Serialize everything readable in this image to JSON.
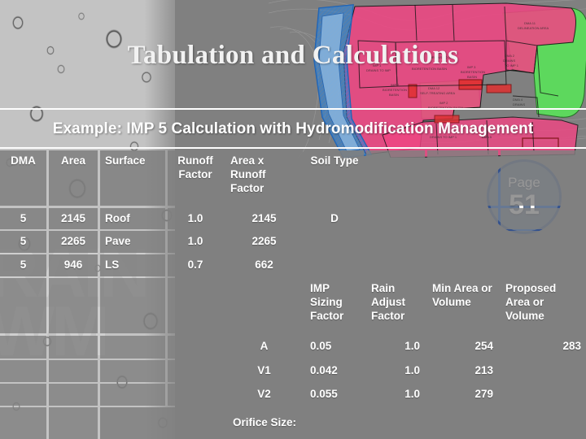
{
  "slide": {
    "title": "Tabulation and Calculations",
    "subtitle": "Example: IMP 5 Calculation with Hydromodification Management",
    "watermark_text": "RAIN\nWM"
  },
  "page_badge": {
    "label": "Page",
    "number": "51",
    "fill_color": "#466eaf",
    "border_color": "#2d4b8c"
  },
  "colors": {
    "background_gray": "#808080",
    "droplet_band": "#c3c3c3",
    "cell_gray": "#808080",
    "text_white": "#ffffff",
    "map_pink": "#ef4683",
    "map_blue": "#2f7fd4",
    "map_light_blue": "#88b4de",
    "map_green": "#5be05b",
    "map_red": "#e03030"
  },
  "map": {
    "name": "site-plan-drainage-map",
    "labels": [
      "DMA 11 DELINEATION AREA",
      "DMA 3 DRAINS TO IMP 5",
      "IMP 1 DRAINS TO IMP",
      "IMP 7 BIORETENTION BASIN",
      "IMP 3 BIORETENTION BASIN",
      "DMA 12 SELF-TREATING AREA",
      "IMP 2 BIORETENTION BASIN",
      "DMA 2 DRAINS TO IMP 1",
      "DMA 4 DRAINS",
      "DRAINS TO IMP 1"
    ]
  },
  "table_top": {
    "headers": [
      "DMA",
      "Area",
      "Surface",
      "Runoff Factor",
      "Area x Runoff Factor",
      "Soil Type",
      "",
      "",
      ""
    ],
    "rows": [
      [
        "5",
        "2145",
        "Roof",
        "1.0",
        "2145",
        "D",
        "",
        "",
        ""
      ],
      [
        "5",
        "2265",
        "Pave",
        "1.0",
        "2265",
        "",
        "",
        "",
        ""
      ],
      [
        "5",
        "946",
        "LS",
        "0.7",
        "662",
        "",
        "",
        "",
        ""
      ]
    ]
  },
  "table_bottom": {
    "headers": [
      "",
      "",
      "IMP Sizing Factor",
      "Rain Adjust Factor",
      "Min Area or Volume",
      "Proposed Area or Volume"
    ],
    "rows": [
      [
        "",
        "A",
        "0.05",
        "1.0",
        "254",
        "283"
      ],
      [
        "",
        "V1",
        "0.042",
        "1.0",
        "213",
        ""
      ],
      [
        "",
        "V2",
        "0.055",
        "1.0",
        "279",
        ""
      ]
    ],
    "footer_label": "Orifice Size:"
  }
}
